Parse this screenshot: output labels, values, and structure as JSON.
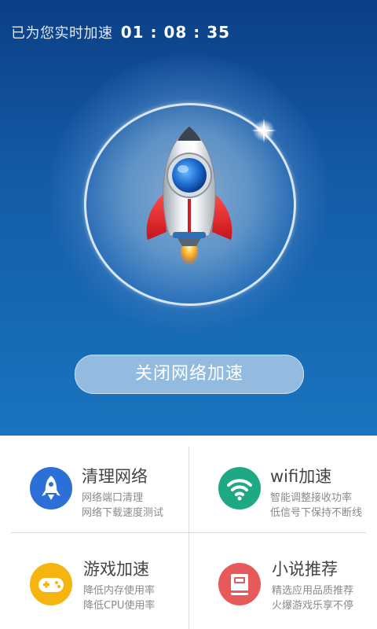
{
  "header": {
    "status_label": "已为您实时加速",
    "timer": "01 : 08 : 35"
  },
  "main": {
    "close_button_label": "关闭网络加速"
  },
  "colors": {
    "accent_blue": "#2c6fd6",
    "wifi_green": "#1fa884",
    "game_yellow": "#f6b40e",
    "novel_red": "#e65a5c"
  },
  "features": [
    {
      "title": "清理网络",
      "lines": [
        "网络端口清理",
        "网络下载速度测试"
      ],
      "icon": "rocket-icon"
    },
    {
      "title": "wifi加速",
      "lines": [
        "智能调整接收功率",
        "低信号下保持不断线"
      ],
      "icon": "wifi-icon"
    },
    {
      "title": "游戏加速",
      "lines": [
        "降低内存使用率",
        "降低CPU使用率"
      ],
      "icon": "gamepad-icon"
    },
    {
      "title": "小说推荐",
      "lines": [
        "精选应用品质推荐",
        "火爆游戏乐享不停"
      ],
      "icon": "book-icon"
    }
  ]
}
